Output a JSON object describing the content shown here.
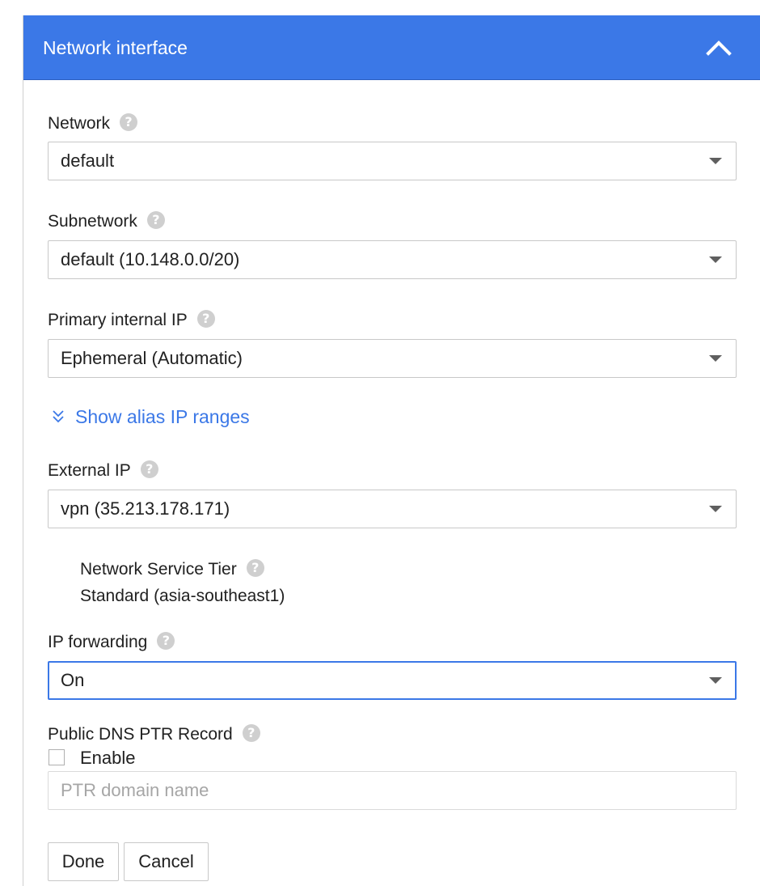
{
  "header": {
    "title": "Network interface",
    "collapse_icon": "chevron-up-icon"
  },
  "network": {
    "label": "Network",
    "help": "?",
    "value": "default"
  },
  "subnetwork": {
    "label": "Subnetwork",
    "help": "?",
    "value": "default (10.148.0.0/20)"
  },
  "primary_internal_ip": {
    "label": "Primary internal IP",
    "help": "?",
    "value": "Ephemeral (Automatic)"
  },
  "alias_ranges": {
    "label": "Show alias IP ranges",
    "icon": "double-chevron-down-icon"
  },
  "external_ip": {
    "label": "External IP",
    "help": "?",
    "value": "vpn (35.213.178.171)"
  },
  "network_service_tier": {
    "label": "Network Service Tier",
    "help": "?",
    "value": "Standard (asia-southeast1)"
  },
  "ip_forwarding": {
    "label": "IP forwarding",
    "help": "?",
    "value": "On"
  },
  "public_dns_ptr": {
    "label": "Public DNS PTR Record",
    "help": "?",
    "enable_label": "Enable",
    "enabled": false,
    "placeholder": "PTR domain name"
  },
  "actions": {
    "done_label": "Done",
    "cancel_label": "Cancel"
  },
  "colors": {
    "header_bg": "#3b78e7",
    "link": "#3b78e7",
    "focus_border": "#3b78e7"
  }
}
